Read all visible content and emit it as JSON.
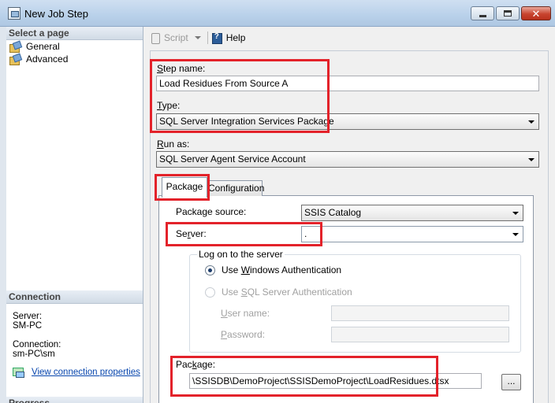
{
  "window": {
    "title": "New Job Step"
  },
  "left_pane": {
    "select_page_header": "Select a page",
    "pages": [
      {
        "label": "General",
        "icon": "properties-page-icon"
      },
      {
        "label": "Advanced",
        "icon": "properties-page-icon"
      }
    ],
    "connection_header": "Connection",
    "server_label": "Server:",
    "server_value": "SM-PC",
    "connection_label": "Connection:",
    "connection_value": "sm-PC\\sm",
    "view_connection_link": "View connection properties",
    "progress_header": "Progress"
  },
  "toolbar": {
    "script_label": "Script",
    "help_label": "Help"
  },
  "form": {
    "step_name_label": "Step name:",
    "step_name_accesskey": "S",
    "step_name_value": "Load Residues From Source A",
    "type_label": "Type:",
    "type_accesskey": "T",
    "type_value": "SQL Server Integration Services Package",
    "run_as_label": "Run as:",
    "run_as_accesskey": "R",
    "run_as_value": "SQL Server Agent Service Account",
    "tabs": [
      "Package",
      "Configuration"
    ],
    "active_tab": "Package",
    "package_source_label": "Package source:",
    "package_source_value": "SSIS Catalog",
    "server_label": "Server:",
    "server_value": ".",
    "logon_group_title": "Log on to the server",
    "windows_auth_label": "Use Windows Authentication",
    "sql_auth_label": "Use SQL Server Authentication",
    "user_name_label": "User name:",
    "password_label": "Password:",
    "package_label": "Package:",
    "package_value": "\\SSISDB\\DemoProject\\SSISDemoProject\\LoadResidues.dtsx",
    "browse_label": "..."
  },
  "colors": {
    "highlight_border": "#e3222a",
    "link": "#0645ad"
  }
}
